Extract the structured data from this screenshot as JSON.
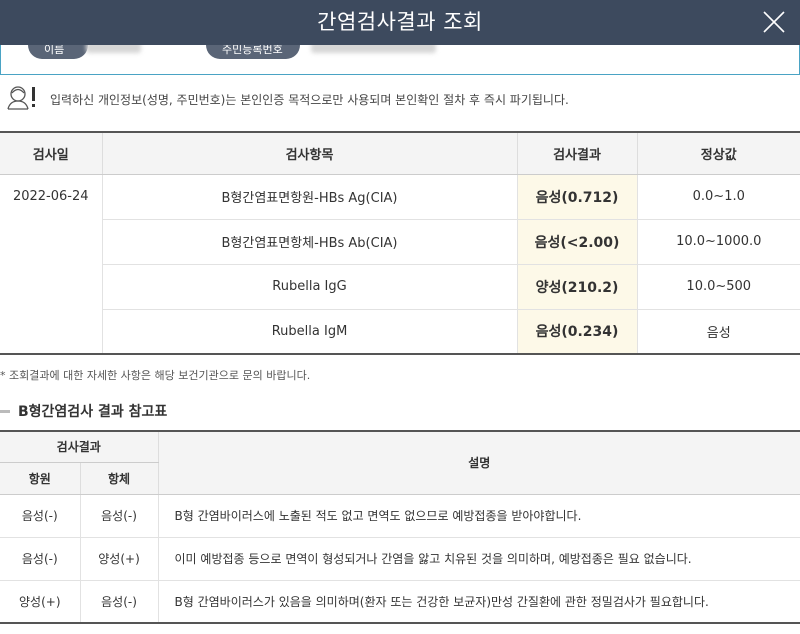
{
  "header": {
    "title": "간염검사결과 조회",
    "close_icon": "close-icon"
  },
  "info": {
    "name_label": "이름",
    "rrn_label": "주민등록번호"
  },
  "notice": {
    "icon": "person-alert-icon",
    "text": "입력하신 개인정보(성명, 주민번호)는 본인인증 목적으로만 사용되며 본인확인 절차 후 즉시 파기됩니다."
  },
  "results": {
    "headers": [
      "검사일",
      "검사항목",
      "검사결과",
      "정상값"
    ],
    "date": "2022-06-24",
    "rows": [
      {
        "item": "B형간염표면항원-HBs Ag(CIA)",
        "result": "음성(0.712)",
        "normal": "0.0~1.0"
      },
      {
        "item": "B형간염표면항체-HBs Ab(CIA)",
        "result": "음성(<2.00)",
        "normal": "10.0~1000.0"
      },
      {
        "item": "Rubella IgG",
        "result": "양성(210.2)",
        "normal": "10.0~500"
      },
      {
        "item": "Rubella IgM",
        "result": "음성(0.234)",
        "normal": "음성"
      }
    ]
  },
  "footnote": "* 조회결과에 대한 자세한 사항은 해당 보건기관으로 문의 바랍니다.",
  "reference": {
    "title": "B형간염검사 결과 참고표",
    "group_header": "검사결과",
    "antigen_header": "항원",
    "antibody_header": "항체",
    "desc_header": "설명",
    "rows": [
      {
        "antigen": "음성(-)",
        "antibody": "음성(-)",
        "desc": "B형 간염바이러스에 노출된 적도 없고 면역도 없으므로 예방접종을 받아야합니다."
      },
      {
        "antigen": "음성(-)",
        "antibody": "양성(+)",
        "desc": "이미 예방접종 등으로 면역이 형성되거나 간염을 앓고 치유된 것을 의미하며, 예방접종은 필요 없습니다."
      },
      {
        "antigen": "양성(+)",
        "antibody": "음성(-)",
        "desc": "B형 간염바이러스가 있음을 의미하며(환자 또는 건강한 보균자)만성 간질환에 관한 정밀검사가 필요합니다."
      }
    ]
  }
}
